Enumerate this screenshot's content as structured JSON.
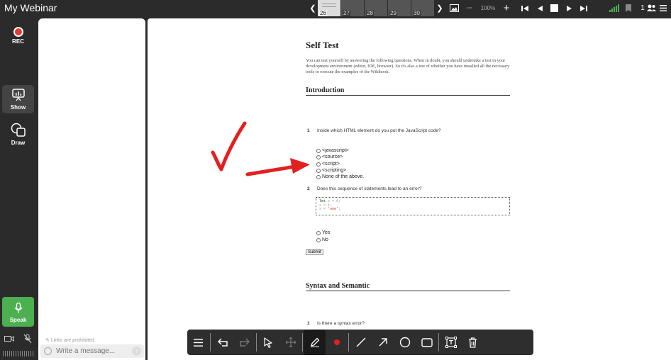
{
  "app": {
    "title": "My Webinar"
  },
  "thumbnails": [
    {
      "num": "26",
      "active": true
    },
    {
      "num": "27",
      "active": false
    },
    {
      "num": "28",
      "active": false
    },
    {
      "num": "29",
      "active": false
    },
    {
      "num": "30",
      "active": false
    }
  ],
  "zoom": {
    "value": "100%"
  },
  "participants": {
    "count": "1"
  },
  "rail": {
    "rec_label": "REC",
    "show_label": "Show",
    "draw_label": "Draw",
    "speak_label": "Speak"
  },
  "chat": {
    "links_notice": "Links are prohibited",
    "placeholder": "Write a message..."
  },
  "document": {
    "title": "Self Test",
    "intro": "You can test yourself by answering the following questions. When in doubt, you should undertake a test in your development environment (editor, IDE, browser). So it's also a test of whether you have installed all the necessary tools to execute the examples of the Wikibook.",
    "section1": "Introduction",
    "q1_num": "1",
    "q1_text": "Inside which HTML element do you put the JavaScript code?",
    "q1_options": [
      "<javascript>",
      "<source>",
      "<script>",
      "<scripting>",
      "None of the above."
    ],
    "q2_num": "2",
    "q2_text": "Does this sequence of statements lead to an error?",
    "code": {
      "l1_kw": "let",
      "l1_rest": " x = 0;",
      "l2": "x = 1;",
      "l3_a": "x = ",
      "l3_str": "'one'",
      "l3_b": ";"
    },
    "q2_options": [
      "Yes",
      "No"
    ],
    "submit": "Submit",
    "section2": "Syntax and Semantic",
    "q3_num": "1",
    "q3_text": "Is there a syntax error?"
  },
  "colors": {
    "annotation": "#e32020",
    "speak": "#4caf50",
    "rec": "#e53935"
  }
}
